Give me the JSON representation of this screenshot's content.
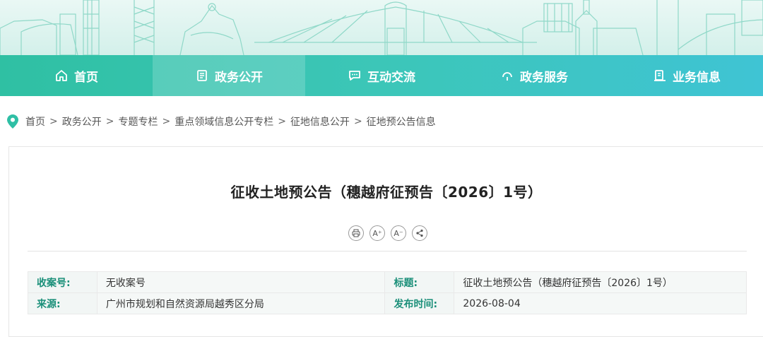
{
  "nav": {
    "items": [
      {
        "label": "首页",
        "icon": "home-icon"
      },
      {
        "label": "政务公开",
        "icon": "document-icon"
      },
      {
        "label": "互动交流",
        "icon": "chat-icon"
      },
      {
        "label": "政务服务",
        "icon": "service-icon"
      },
      {
        "label": "业务信息",
        "icon": "briefcase-icon"
      }
    ],
    "active_index": 1
  },
  "breadcrumb": [
    "首页",
    "政务公开",
    "专题专栏",
    "重点领域信息公开专栏",
    "征地信息公开",
    "征地预公告信息"
  ],
  "breadcrumb_separator": ">",
  "article": {
    "title": "征收土地预公告（穗越府征预告〔2026〕1号）",
    "tools": {
      "print": "print-icon",
      "font_large": "A⁺",
      "font_small": "A⁻",
      "share": "share-icon"
    }
  },
  "info": {
    "index_label": "收案号:",
    "index_value": "无收案号",
    "title_label": "标题:",
    "title_value": "征收土地预公告（穗越府征预告〔2026〕1号）",
    "source_label": "来源:",
    "source_value": "广州市规划和自然资源局越秀区分局",
    "date_label": "发布时间:",
    "date_value": "2026-08-04"
  },
  "colors": {
    "nav_start": "#2fc0a3",
    "nav_end": "#3fc4d4",
    "info_key": "#1a8f79",
    "pin": "#2fbfa5"
  }
}
